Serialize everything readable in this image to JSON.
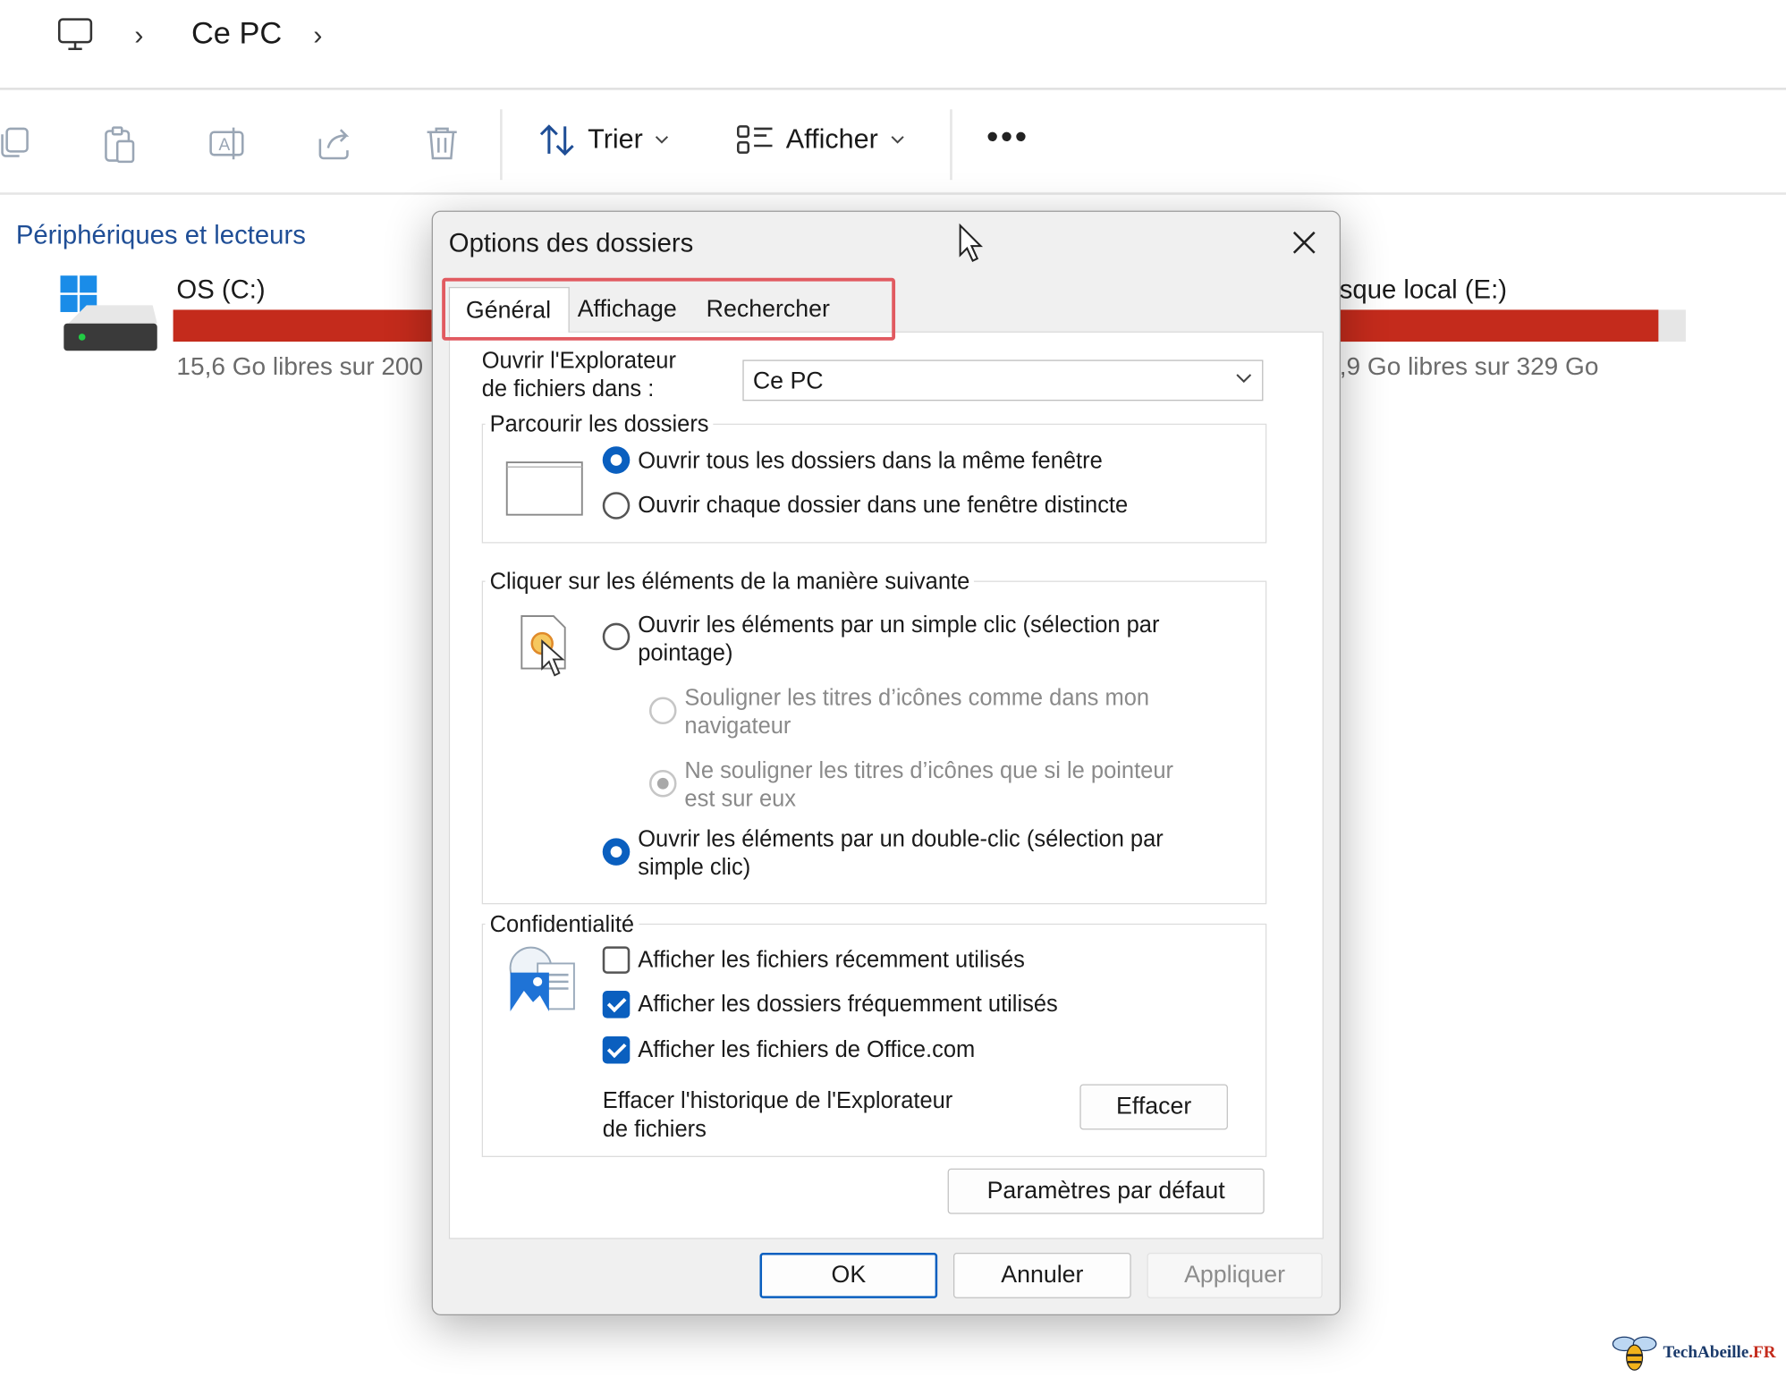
{
  "address": {
    "location": "Ce PC"
  },
  "toolbar": {
    "sort_label": "Trier",
    "view_label": "Afficher",
    "more_label": "•••"
  },
  "explorer": {
    "section_title": "Périphériques et lecteurs",
    "drives": [
      {
        "name": "OS (C:)",
        "free_text": "15,6 Go libres sur 200",
        "used_fraction": 0.92
      },
      {
        "name": "sque local (E:)",
        "free_text": ",9 Go libres sur 329 Go",
        "used_fraction": 0.92
      }
    ]
  },
  "dialog": {
    "title": "Options des dossiers",
    "tabs": [
      {
        "label": "Général",
        "active": true
      },
      {
        "label": "Affichage",
        "active": false
      },
      {
        "label": "Rechercher",
        "active": false
      }
    ],
    "open_in": {
      "label_line1": "Ouvrir l'Explorateur",
      "label_line2": "de fichiers dans :",
      "value": "Ce PC"
    },
    "browse": {
      "title": "Parcourir les dossiers",
      "options": [
        {
          "label": "Ouvrir tous les dossiers dans la même fenêtre",
          "checked": true
        },
        {
          "label": "Ouvrir chaque dossier dans une fenêtre distincte",
          "checked": false
        }
      ]
    },
    "click": {
      "title": "Cliquer sur les éléments de la manière suivante",
      "single_click": {
        "line1": "Ouvrir les éléments par un simple clic (sélection par",
        "line2": "pointage)",
        "checked": false
      },
      "underline_browser": {
        "line1": "Souligner les titres d’icônes comme dans mon",
        "line2": "navigateur",
        "checked": false,
        "disabled": true
      },
      "underline_hover": {
        "line1": "Ne souligner les titres d’icônes que si le pointeur",
        "line2": "est sur eux",
        "checked": true,
        "disabled": true
      },
      "double_click": {
        "line1": "Ouvrir les éléments par un double-clic (sélection par",
        "line2": "simple clic)",
        "checked": true
      }
    },
    "privacy": {
      "title": "Confidentialité",
      "options": [
        {
          "label": "Afficher les fichiers récemment utilisés",
          "checked": false
        },
        {
          "label": "Afficher les dossiers fréquemment utilisés",
          "checked": true
        },
        {
          "label": "Afficher les fichiers de Office.com",
          "checked": true
        }
      ],
      "clear_label_line1": "Effacer l'historique de l'Explorateur",
      "clear_label_line2": "de fichiers",
      "clear_button": "Effacer"
    },
    "defaults_button": "Paramètres par défaut",
    "ok_button": "OK",
    "cancel_button": "Annuler",
    "apply_button": "Appliquer"
  },
  "watermark": {
    "brand": "TechAbeille",
    "suffix": ".FR"
  },
  "colors": {
    "accent": "#0a5fbf",
    "drive_bar": "#c42b1c",
    "tab_highlight": "#e15a60",
    "section_link": "#1f4e96"
  }
}
